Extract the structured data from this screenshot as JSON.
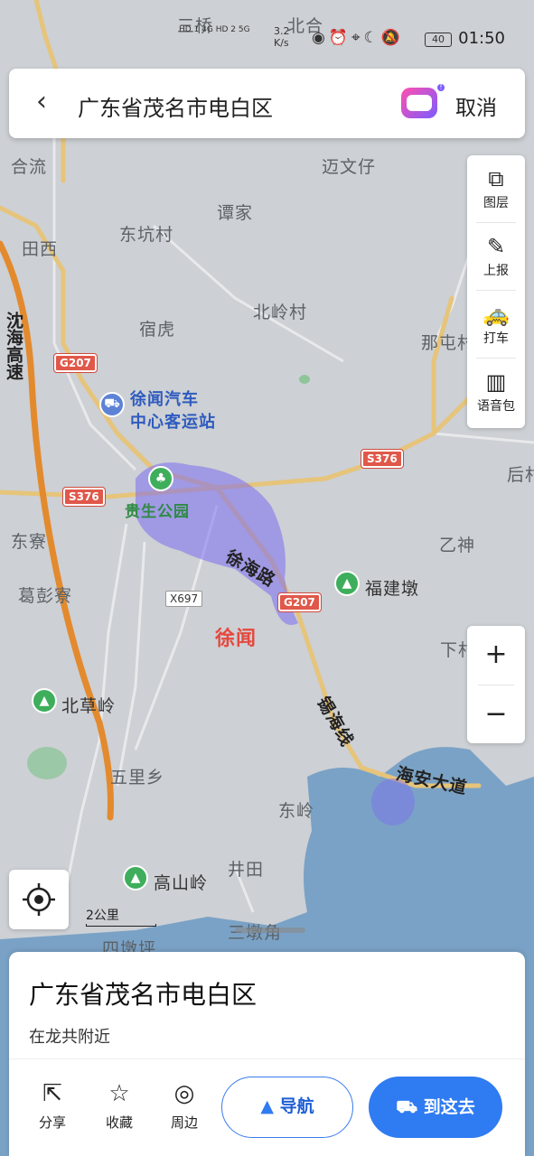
{
  "status_bar": {
    "network": "HD 1 4G HD 2 5G",
    "speed_value": "3.2",
    "speed_unit": "K/s",
    "icons": [
      "eye-icon",
      "alarm-icon",
      "location-icon",
      "moon-icon",
      "mute-icon"
    ],
    "battery": "40",
    "time": "01:50"
  },
  "search_bar": {
    "back": "back-icon",
    "query": "广东省茂名市电白区",
    "cancel_label": "取消"
  },
  "map": {
    "places": [
      {
        "name": "三桥"
      },
      {
        "name": "北合"
      },
      {
        "name": "合流"
      },
      {
        "name": "迈文仔"
      },
      {
        "name": "谭家"
      },
      {
        "name": "东坑村"
      },
      {
        "name": "田西"
      },
      {
        "name": "北岭村"
      },
      {
        "name": "宿虎"
      },
      {
        "name": "那屯村"
      },
      {
        "name": "后村"
      },
      {
        "name": "东寮"
      },
      {
        "name": "乙神"
      },
      {
        "name": "葛彭寮"
      },
      {
        "name": "下村"
      },
      {
        "name": "五里乡"
      },
      {
        "name": "东岭"
      },
      {
        "name": "井田"
      },
      {
        "name": "三墩角"
      },
      {
        "name": "四墩坪"
      }
    ],
    "pois": [
      {
        "name": "徐闻汽车中心客运站",
        "line1": "徐闻汽车",
        "line2": "中心客运站",
        "type": "bus"
      },
      {
        "name": "贵生公园",
        "type": "park"
      },
      {
        "name": "福建墩",
        "type": "mountain"
      },
      {
        "name": "北草岭",
        "type": "mountain"
      },
      {
        "name": "高山岭",
        "type": "mountain"
      }
    ],
    "city_label": "徐闻",
    "roads": {
      "expressway": "沈海高速",
      "g207": "G207",
      "s376": "S376",
      "x697": "X697",
      "xuhai_road": "徐海路",
      "xihai_line": "锡海线",
      "haian_avenue": "海安大道"
    },
    "scale_label": "2公里"
  },
  "tools": [
    {
      "label": "图层",
      "icon": "layers-icon"
    },
    {
      "label": "上报",
      "icon": "report-icon"
    },
    {
      "label": "打车",
      "icon": "taxi-icon"
    },
    {
      "label": "语音包",
      "icon": "voice-pack-icon"
    }
  ],
  "zoom": {
    "in": "+",
    "out": "−"
  },
  "bottom_sheet": {
    "title": "广东省茂名市电白区",
    "subtitle": "在龙共附近",
    "actions": [
      {
        "label": "分享",
        "icon": "share-icon"
      },
      {
        "label": "收藏",
        "icon": "star-icon"
      },
      {
        "label": "周边",
        "icon": "compass-icon"
      }
    ],
    "navigate_label": "导航",
    "go_label": "到这去"
  },
  "colors": {
    "map_bg": "#cdd0d4",
    "sea": "#7aa2c6",
    "expressway": "#e38a2e",
    "primary_road": "#e9c77a",
    "accent": "#2f7bf2",
    "heat": "#7b6cf0"
  }
}
